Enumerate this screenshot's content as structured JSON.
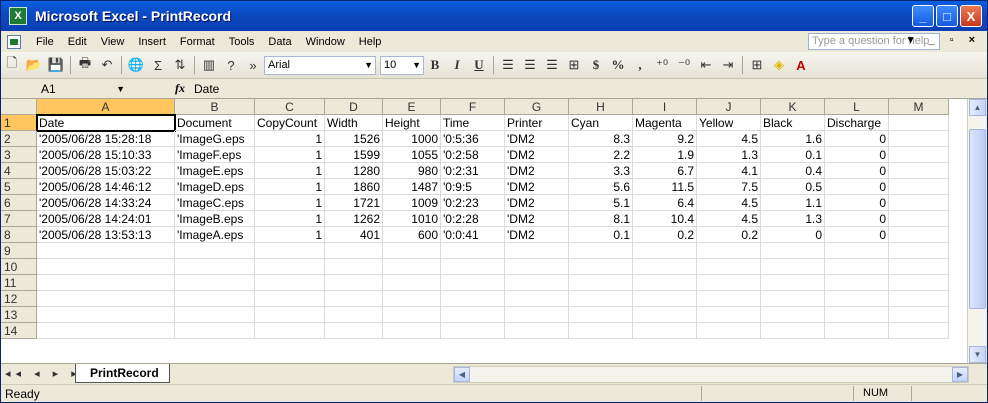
{
  "window": {
    "title": "Microsoft Excel - PrintRecord",
    "app_icon": "X",
    "controls": [
      "_",
      "□",
      "X"
    ]
  },
  "menu": {
    "items": [
      "File",
      "Edit",
      "View",
      "Insert",
      "Format",
      "Tools",
      "Data",
      "Window",
      "Help"
    ],
    "help_placeholder": "Type a question for help",
    "doc_controls": "▾ _ ▫ ×"
  },
  "toolbar": {
    "font_name": "Arial",
    "font_size": "10",
    "bold": "B",
    "italic": "I",
    "underline": "U",
    "currency": "$",
    "percent": "%",
    "comma": ","
  },
  "formula_bar": {
    "name_box": "A1",
    "fx": "fx",
    "value": "Date"
  },
  "grid": {
    "columns": [
      "A",
      "B",
      "C",
      "D",
      "E",
      "F",
      "G",
      "H",
      "I",
      "J",
      "K",
      "L",
      "M"
    ],
    "rows": [
      [
        "Date",
        "Document",
        "CopyCount",
        "Width",
        "Height",
        "Time",
        "Printer",
        "Cyan",
        "Magenta",
        "Yellow",
        "Black",
        "Discharge",
        ""
      ],
      [
        "'2005/06/28 15:28:18",
        "'ImageG.eps",
        "1",
        "1526",
        "1000",
        "'0:5:36",
        "'DM2",
        "8.3",
        "9.2",
        "4.5",
        "1.6",
        "0",
        ""
      ],
      [
        "'2005/06/28 15:10:33",
        "'ImageF.eps",
        "1",
        "1599",
        "1055",
        "'0:2:58",
        "'DM2",
        "2.2",
        "1.9",
        "1.3",
        "0.1",
        "0",
        ""
      ],
      [
        "'2005/06/28 15:03:22",
        "'ImageE.eps",
        "1",
        "1280",
        "980",
        "'0:2:31",
        "'DM2",
        "3.3",
        "6.7",
        "4.1",
        "0.4",
        "0",
        ""
      ],
      [
        "'2005/06/28 14:46:12",
        "'ImageD.eps",
        "1",
        "1860",
        "1487",
        "'0:9:5",
        "'DM2",
        "5.6",
        "11.5",
        "7.5",
        "0.5",
        "0",
        ""
      ],
      [
        "'2005/06/28 14:33:24",
        "'ImageC.eps",
        "1",
        "1721",
        "1009",
        "'0:2:23",
        "'DM2",
        "5.1",
        "6.4",
        "4.5",
        "1.1",
        "0",
        ""
      ],
      [
        "'2005/06/28 14:24:01",
        "'ImageB.eps",
        "1",
        "1262",
        "1010",
        "'0:2:28",
        "'DM2",
        "8.1",
        "10.4",
        "4.5",
        "1.3",
        "0",
        ""
      ],
      [
        "'2005/06/28 13:53:13",
        "'ImageA.eps",
        "1",
        "401",
        "600",
        "'0:0:41",
        "'DM2",
        "0.1",
        "0.2",
        "0.2",
        "0",
        "0",
        ""
      ],
      [
        "",
        "",
        "",
        "",
        "",
        "",
        "",
        "",
        "",
        "",
        "",
        "",
        ""
      ],
      [
        "",
        "",
        "",
        "",
        "",
        "",
        "",
        "",
        "",
        "",
        "",
        "",
        ""
      ],
      [
        "",
        "",
        "",
        "",
        "",
        "",
        "",
        "",
        "",
        "",
        "",
        "",
        ""
      ],
      [
        "",
        "",
        "",
        "",
        "",
        "",
        "",
        "",
        "",
        "",
        "",
        "",
        ""
      ],
      [
        "",
        "",
        "",
        "",
        "",
        "",
        "",
        "",
        "",
        "",
        "",
        "",
        ""
      ],
      [
        "",
        "",
        "",
        "",
        "",
        "",
        "",
        "",
        "",
        "",
        "",
        "",
        ""
      ]
    ],
    "numeric_columns": [
      2,
      3,
      4,
      7,
      8,
      9,
      10,
      11
    ]
  },
  "sheets": {
    "active": "PrintRecord",
    "nav": "◂◂ ◂ ▸ ▸▸"
  },
  "status": {
    "left": "Ready",
    "num": "NUM"
  }
}
